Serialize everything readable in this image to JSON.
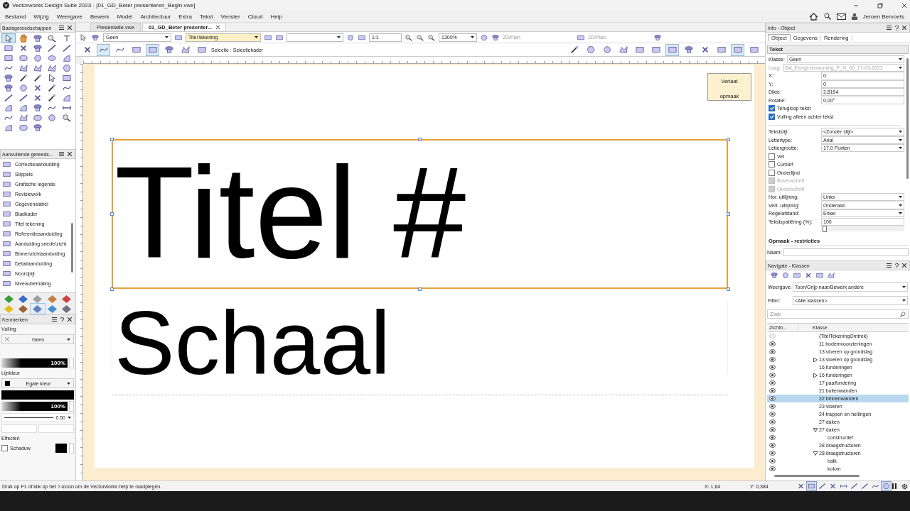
{
  "window": {
    "title": "Vectorworks Design Suite 2023 - [01_GD_Beter presenteren_Begin.vwx]"
  },
  "menu": [
    "Bestand",
    "Wijzig",
    "Weergave",
    "Bewerk",
    "Model",
    "Architectuur",
    "Extra",
    "Tekst",
    "Venster",
    "Cloud",
    "Help"
  ],
  "user": {
    "name": "Jeroen Bervoets"
  },
  "tool_palette": {
    "title": "Basisgereedschappen",
    "tools": [
      {
        "kind": "pointer",
        "selected": true
      },
      {
        "kind": "hand",
        "selected": false
      },
      {
        "kind": "blob",
        "selected": false
      },
      {
        "kind": "zoom",
        "selected": false
      },
      {
        "kind": "text",
        "selected": false
      },
      {
        "kind": "rect",
        "selected": false
      },
      {
        "kind": "cross",
        "selected": false
      },
      {
        "kind": "blob",
        "selected": false
      },
      {
        "kind": "line",
        "selected": false
      },
      {
        "kind": "line",
        "selected": false
      },
      {
        "kind": "rect",
        "selected": false
      },
      {
        "kind": "roundrect",
        "selected": false
      },
      {
        "kind": "circle",
        "selected": false
      },
      {
        "kind": "oval",
        "selected": false
      },
      {
        "kind": "arc",
        "selected": false
      },
      {
        "kind": "curve",
        "selected": false
      },
      {
        "kind": "polygon",
        "selected": false
      },
      {
        "kind": "polygon",
        "selected": false
      },
      {
        "kind": "polygon",
        "selected": false
      },
      {
        "kind": "hexagon",
        "selected": false
      },
      {
        "kind": "blob",
        "selected": false
      },
      {
        "kind": "wand",
        "selected": false
      },
      {
        "kind": "wand",
        "selected": false
      },
      {
        "kind": "pointer",
        "selected": false
      },
      {
        "kind": "rect",
        "selected": false
      },
      {
        "kind": "blob",
        "selected": false
      },
      {
        "kind": "circle",
        "selected": false
      },
      {
        "kind": "cross",
        "selected": false
      },
      {
        "kind": "wand",
        "selected": false
      },
      {
        "kind": "curve",
        "selected": false
      },
      {
        "kind": "line",
        "selected": false
      },
      {
        "kind": "line",
        "selected": false
      },
      {
        "kind": "cross",
        "selected": false
      },
      {
        "kind": "wand",
        "selected": false
      },
      {
        "kind": "arc",
        "selected": false
      },
      {
        "kind": "arc",
        "selected": false
      },
      {
        "kind": "arc",
        "selected": false
      },
      {
        "kind": "blob",
        "selected": false
      },
      {
        "kind": "curve",
        "selected": false
      },
      {
        "kind": "dimension",
        "selected": false
      },
      {
        "kind": "curve",
        "selected": false
      },
      {
        "kind": "polygon",
        "selected": false
      },
      {
        "kind": "roundrect",
        "selected": false
      },
      {
        "kind": "circle",
        "selected": false
      },
      {
        "kind": "zoom",
        "selected": false
      },
      {
        "kind": "arc",
        "selected": false
      },
      {
        "kind": "roundrect",
        "selected": false
      },
      {
        "kind": "blob",
        "selected": false
      }
    ]
  },
  "extra_palette": {
    "title": "Aanvullende gereeds...",
    "items": [
      "Correctieaanduiding",
      "Stippels",
      "Grafische legende",
      "Revisiewolk",
      "Gegevenslabel",
      "Bladkader",
      "Titel tekening",
      "Referentieaanduiding",
      "Aanduiding snede/zicht",
      "Binnenzichtaanduiding",
      "Detailaanduiding",
      "Noordpijl",
      "Niveaubemating"
    ]
  },
  "categories": [
    {
      "color": "#3a9a3a",
      "selected": false
    },
    {
      "color": "#3a6ad0",
      "selected": false
    },
    {
      "color": "#a0a0a0",
      "selected": false
    },
    {
      "color": "#c08040",
      "selected": false
    },
    {
      "color": "#d04040",
      "selected": false
    },
    {
      "color": "#e0c020",
      "selected": false
    },
    {
      "color": "#a06030",
      "selected": false
    },
    {
      "color": "#6080c0",
      "selected": true
    },
    {
      "color": "#4090d0",
      "selected": false
    },
    {
      "color": "#707080",
      "selected": false
    }
  ],
  "attributes": {
    "title": "Kenmerken",
    "fill_label": "Vulling",
    "fill_style": "Geen",
    "fill_opacity": "100%",
    "pen_label": "Lijnkleur",
    "pen_style": "Egale kleur",
    "pen_opacity": "100%",
    "thickness": "0.50",
    "effects_label": "Effecten",
    "shadow": {
      "label": "Schaduw",
      "checked": false
    }
  },
  "doc_tabs": [
    {
      "label": "Presentatie.vwx",
      "selected": false,
      "closable": false
    },
    {
      "label": "01_GD_Beter presenter...",
      "selected": true,
      "closable": true
    }
  ],
  "view_bar": {
    "class": "Geen",
    "layer": "Titel tekening",
    "scale": "1:1",
    "zoom": "1300%",
    "view_1": "2D/Plan",
    "view_2": "2D/Plan"
  },
  "mode_bar": {
    "label": "Selectie : Selectiekader"
  },
  "canvas": {
    "exit_button": "Verlaat opmaak",
    "title_text": "Titel #",
    "title_selected": true,
    "scale_text": "Schaal"
  },
  "info": {
    "title": "Info - Object",
    "tabs": [
      {
        "label": "Object",
        "selected": true
      },
      {
        "label": "Gegevens",
        "selected": false
      },
      {
        "label": "Rendering",
        "selected": false
      }
    ],
    "section": "Tekst",
    "fields": [
      {
        "kind": "wide_dropdown",
        "label": "Klasse:",
        "value": "Geen",
        "disabled": false
      },
      {
        "kind": "wide_dropdown",
        "label": "Laag:",
        "value": "BA_Eengezinswoning_P_N_00_17-03-2023",
        "disabled": true
      },
      {
        "kind": "text",
        "label": "X:",
        "value": "0",
        "disabled": false
      },
      {
        "kind": "text",
        "label": "Y:",
        "value": "0",
        "disabled": false
      },
      {
        "kind": "text",
        "label": "Dikte:",
        "value": "2.8194",
        "disabled": false
      },
      {
        "kind": "text",
        "label": "Rotatie:",
        "value": "0,00°",
        "disabled": false
      },
      {
        "kind": "checkbox",
        "label": "Terugloop tekst",
        "checked": true,
        "disabled": false
      },
      {
        "kind": "checkbox",
        "label": "Vulling alleen achter tekst",
        "checked": true,
        "disabled": false
      },
      {
        "kind": "divider"
      },
      {
        "kind": "dropdown",
        "label": "Tekststijl:",
        "value": "<Zonder stijl>",
        "disabled": false
      },
      {
        "kind": "dropdown",
        "label": "Lettertype:",
        "value": "Arial",
        "disabled": false
      },
      {
        "kind": "dropdown",
        "label": "Lettergrootte:",
        "value": "17.0 Punten",
        "disabled": false
      },
      {
        "kind": "checkbox",
        "label": "Vet",
        "checked": false,
        "disabled": false
      },
      {
        "kind": "checkbox",
        "label": "Cursief",
        "checked": false,
        "disabled": false
      },
      {
        "kind": "checkbox",
        "label": "Onderlijnd",
        "checked": false,
        "disabled": false
      },
      {
        "kind": "checkbox",
        "label": "Bovenschrift",
        "checked": false,
        "disabled": true
      },
      {
        "kind": "checkbox",
        "label": "Onderschrift",
        "checked": false,
        "disabled": true
      },
      {
        "kind": "dropdown",
        "label": "Hor. uitlijning:",
        "value": "Links",
        "disabled": false
      },
      {
        "kind": "dropdown",
        "label": "Vert. uitlijning:",
        "value": "Onderaan",
        "disabled": false
      },
      {
        "kind": "dropdown",
        "label": "Regelafstand:",
        "value": "Enkel",
        "disabled": false
      },
      {
        "kind": "text",
        "label": "Tekstspatiëring (%):",
        "value": "100",
        "disabled": false
      },
      {
        "kind": "slider",
        "level": 0.02
      }
    ],
    "subsection": "Opmaak - restricties",
    "name_label": "Naam:"
  },
  "navigator": {
    "title": "Navigate - Klassen",
    "view_label": "Weergave:",
    "view": "Toon/Grijp naar/Bewerk andere",
    "filter_label": "Filter:",
    "filter": "<Alle klassen>",
    "search_placeholder": "Zoek",
    "columns": [
      "Zichtb...",
      "Klasse"
    ],
    "rows": [
      {
        "name": "{TitelTekeningOmtrek}",
        "visible": false,
        "selected": false
      },
      {
        "name": "11 bodemvoorzieningen",
        "visible": true,
        "selected": false
      },
      {
        "name": "13 vloeren op grondslag",
        "visible": true,
        "selected": false
      },
      {
        "name": "13 vloeren op grondslag",
        "visible": true,
        "selected": false,
        "expanded": false
      },
      {
        "name": "16 funderingen",
        "visible": true,
        "selected": false
      },
      {
        "name": "16 funderingen",
        "visible": true,
        "selected": false,
        "expanded": false
      },
      {
        "name": "17 paalfundering",
        "visible": true,
        "selected": false
      },
      {
        "name": "21 buitenwanden",
        "visible": true,
        "selected": false
      },
      {
        "name": "22 binnenwanden",
        "visible": true,
        "selected": true
      },
      {
        "name": "23 vloeren",
        "visible": true,
        "selected": false
      },
      {
        "name": "24 trappen en hellingen",
        "visible": true,
        "selected": false
      },
      {
        "name": "27 daken",
        "visible": true,
        "selected": false
      },
      {
        "name": "27 daken",
        "visible": true,
        "selected": false,
        "expanded": true,
        "children": [
          {
            "name": "constructief",
            "visible": true,
            "selected": false
          }
        ]
      },
      {
        "name": "28 draagstructuren",
        "visible": true,
        "selected": false
      },
      {
        "name": "28 draagstructuren",
        "visible": true,
        "selected": false,
        "expanded": true,
        "children": [
          {
            "name": "balk",
            "visible": true,
            "selected": false
          },
          {
            "name": "kolom",
            "visible": true,
            "selected": false
          }
        ]
      }
    ]
  },
  "snaps": [
    {
      "selected": false
    },
    {
      "selected": true
    },
    {
      "selected": false
    },
    {
      "selected": false
    },
    {
      "selected": false
    },
    {
      "selected": false
    },
    {
      "selected": false
    },
    {
      "selected": false
    },
    {
      "selected": true
    }
  ],
  "status_bar": {
    "hint": "Druk op F1 of klik op het ?-icoon om de Vectorworks help te raadplegen.",
    "x": "X: 1,64",
    "y": "Y: 0,384"
  }
}
